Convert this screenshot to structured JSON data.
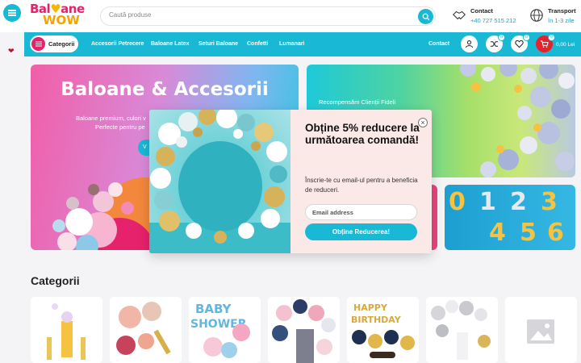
{
  "header": {
    "logo_line1_a": "Bal",
    "logo_line1_heart": "♥",
    "logo_line1_b": "ane",
    "logo_line2": "WOW",
    "search_placeholder": "Caută produse",
    "contact_title": "Contact",
    "contact_phone": "+40 727 515 212",
    "transport_title": "Transport",
    "transport_sub": "în 1-3 zile"
  },
  "nav": {
    "categories_label": "Categorii",
    "links": [
      "Accesorii Petrecere",
      "Baloane Latex",
      "Seturi Baloane",
      "Confetti",
      "Lumanari"
    ],
    "contact": "Contact",
    "compare_count": "0",
    "wishlist_count": "0",
    "cart_count": "0",
    "cart_total": "0,00 Lei"
  },
  "hero": {
    "main_title": "Baloane & Accesorii",
    "main_line1": "Baloane premium, culori v",
    "main_line2": "Perfecte pentru pe",
    "main_cta": "V",
    "promo_text": "Recompensăm Clienții Fideli",
    "numbers_row1": [
      "0",
      "1",
      "2",
      "3"
    ],
    "numbers_row2": [
      "4",
      "5",
      "6"
    ]
  },
  "categories": {
    "title": "Categorii"
  },
  "popup": {
    "title": "Obține 5% reducere la următoarea comandă!",
    "description": "Înscrie-te cu email-ul pentru a beneficia de reduceri.",
    "email_placeholder": "Email address",
    "submit_label": "Obține Reducerea!",
    "close_symbol": "×"
  },
  "colors": {
    "accent": "#19b9d6",
    "brand_pink": "#e5226b",
    "cart_red": "#e5222d",
    "popup_bg": "#fbe9e8"
  }
}
